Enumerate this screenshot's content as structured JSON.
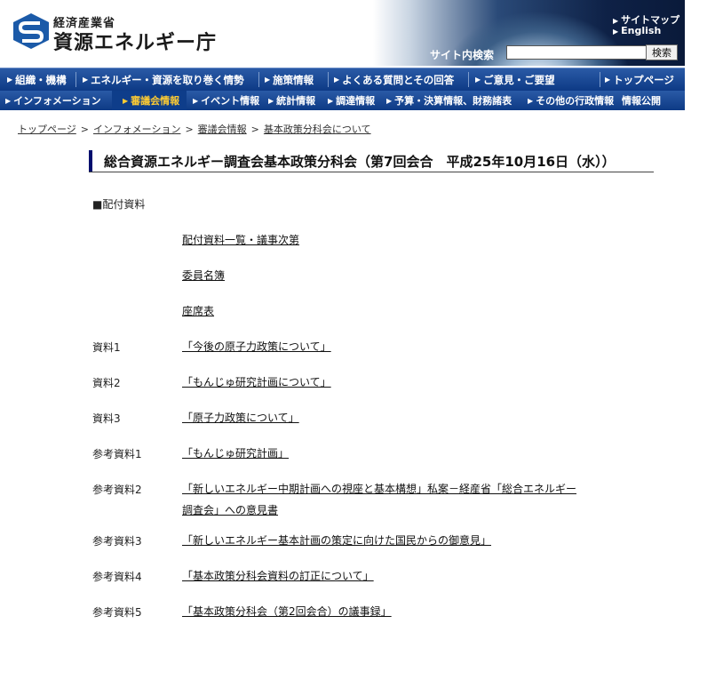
{
  "header": {
    "ministry": "経済産業省",
    "agency": "資源エネルギー庁",
    "sitemap": "サイトマップ",
    "english": "English",
    "search_label": "サイト内検索",
    "search_value": "",
    "search_button": "検索"
  },
  "nav_primary": [
    "組織・機構",
    "エネルギー・資源を取り巻く情勢",
    "施策情報",
    "よくある質問とその回答",
    "ご意見・ご要望",
    "トップページ"
  ],
  "nav_secondary": {
    "section": "インフォメーション",
    "items": [
      "審議会情報",
      "イベント情報",
      "統計情報",
      "調達情報",
      "予算・決算情報、財務諸表",
      "その他の行政情報",
      "情報公開"
    ]
  },
  "breadcrumb": [
    "トップページ",
    "インフォメーション",
    "審議会情報",
    "基本政策分科会について"
  ],
  "page_title": "総合資源エネルギー調査会基本政策分科会（第7回会合　平成25年10月16日（水））",
  "section_heading": "■配付資料",
  "documents": [
    {
      "label": "",
      "title": "配付資料一覧・議事次第"
    },
    {
      "label": "",
      "title": "委員名簿"
    },
    {
      "label": "",
      "title": "座席表"
    },
    {
      "label": "資料1",
      "title": "「今後の原子力政策について」"
    },
    {
      "label": "資料2",
      "title": "「もんじゅ研究計画について」"
    },
    {
      "label": "資料3",
      "title": "「原子力政策について」"
    },
    {
      "label": "参考資料1",
      "title": "「もんじゅ研究計画」"
    },
    {
      "label": "参考資料2",
      "title": "「新しいエネルギー中期計画への視座と基本構想」私案－経産省「総合エネルギー",
      "title_line2": "調査会」への意見書"
    },
    {
      "label": "参考資料3",
      "title": "「新しいエネルギー基本計画の策定に向けた国民からの御意見」"
    },
    {
      "label": "参考資料4",
      "title": "「基本政策分科会資料の訂正について」"
    },
    {
      "label": "参考資料5",
      "title": "「基本政策分科会（第2回会合）の議事録」"
    }
  ]
}
